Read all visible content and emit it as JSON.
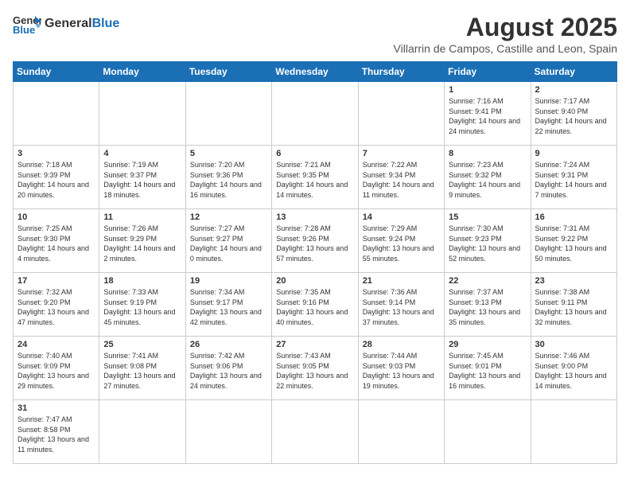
{
  "logo": {
    "text_general": "General",
    "text_blue": "Blue"
  },
  "calendar": {
    "title": "August 2025",
    "subtitle": "Villarrin de Campos, Castille and Leon, Spain",
    "headers": [
      "Sunday",
      "Monday",
      "Tuesday",
      "Wednesday",
      "Thursday",
      "Friday",
      "Saturday"
    ],
    "weeks": [
      [
        {
          "day": "",
          "info": ""
        },
        {
          "day": "",
          "info": ""
        },
        {
          "day": "",
          "info": ""
        },
        {
          "day": "",
          "info": ""
        },
        {
          "day": "",
          "info": ""
        },
        {
          "day": "1",
          "info": "Sunrise: 7:16 AM\nSunset: 9:41 PM\nDaylight: 14 hours and 24 minutes."
        },
        {
          "day": "2",
          "info": "Sunrise: 7:17 AM\nSunset: 9:40 PM\nDaylight: 14 hours and 22 minutes."
        }
      ],
      [
        {
          "day": "3",
          "info": "Sunrise: 7:18 AM\nSunset: 9:39 PM\nDaylight: 14 hours and 20 minutes."
        },
        {
          "day": "4",
          "info": "Sunrise: 7:19 AM\nSunset: 9:37 PM\nDaylight: 14 hours and 18 minutes."
        },
        {
          "day": "5",
          "info": "Sunrise: 7:20 AM\nSunset: 9:36 PM\nDaylight: 14 hours and 16 minutes."
        },
        {
          "day": "6",
          "info": "Sunrise: 7:21 AM\nSunset: 9:35 PM\nDaylight: 14 hours and 14 minutes."
        },
        {
          "day": "7",
          "info": "Sunrise: 7:22 AM\nSunset: 9:34 PM\nDaylight: 14 hours and 11 minutes."
        },
        {
          "day": "8",
          "info": "Sunrise: 7:23 AM\nSunset: 9:32 PM\nDaylight: 14 hours and 9 minutes."
        },
        {
          "day": "9",
          "info": "Sunrise: 7:24 AM\nSunset: 9:31 PM\nDaylight: 14 hours and 7 minutes."
        }
      ],
      [
        {
          "day": "10",
          "info": "Sunrise: 7:25 AM\nSunset: 9:30 PM\nDaylight: 14 hours and 4 minutes."
        },
        {
          "day": "11",
          "info": "Sunrise: 7:26 AM\nSunset: 9:29 PM\nDaylight: 14 hours and 2 minutes."
        },
        {
          "day": "12",
          "info": "Sunrise: 7:27 AM\nSunset: 9:27 PM\nDaylight: 14 hours and 0 minutes."
        },
        {
          "day": "13",
          "info": "Sunrise: 7:28 AM\nSunset: 9:26 PM\nDaylight: 13 hours and 57 minutes."
        },
        {
          "day": "14",
          "info": "Sunrise: 7:29 AM\nSunset: 9:24 PM\nDaylight: 13 hours and 55 minutes."
        },
        {
          "day": "15",
          "info": "Sunrise: 7:30 AM\nSunset: 9:23 PM\nDaylight: 13 hours and 52 minutes."
        },
        {
          "day": "16",
          "info": "Sunrise: 7:31 AM\nSunset: 9:22 PM\nDaylight: 13 hours and 50 minutes."
        }
      ],
      [
        {
          "day": "17",
          "info": "Sunrise: 7:32 AM\nSunset: 9:20 PM\nDaylight: 13 hours and 47 minutes."
        },
        {
          "day": "18",
          "info": "Sunrise: 7:33 AM\nSunset: 9:19 PM\nDaylight: 13 hours and 45 minutes."
        },
        {
          "day": "19",
          "info": "Sunrise: 7:34 AM\nSunset: 9:17 PM\nDaylight: 13 hours and 42 minutes."
        },
        {
          "day": "20",
          "info": "Sunrise: 7:35 AM\nSunset: 9:16 PM\nDaylight: 13 hours and 40 minutes."
        },
        {
          "day": "21",
          "info": "Sunrise: 7:36 AM\nSunset: 9:14 PM\nDaylight: 13 hours and 37 minutes."
        },
        {
          "day": "22",
          "info": "Sunrise: 7:37 AM\nSunset: 9:13 PM\nDaylight: 13 hours and 35 minutes."
        },
        {
          "day": "23",
          "info": "Sunrise: 7:38 AM\nSunset: 9:11 PM\nDaylight: 13 hours and 32 minutes."
        }
      ],
      [
        {
          "day": "24",
          "info": "Sunrise: 7:40 AM\nSunset: 9:09 PM\nDaylight: 13 hours and 29 minutes."
        },
        {
          "day": "25",
          "info": "Sunrise: 7:41 AM\nSunset: 9:08 PM\nDaylight: 13 hours and 27 minutes."
        },
        {
          "day": "26",
          "info": "Sunrise: 7:42 AM\nSunset: 9:06 PM\nDaylight: 13 hours and 24 minutes."
        },
        {
          "day": "27",
          "info": "Sunrise: 7:43 AM\nSunset: 9:05 PM\nDaylight: 13 hours and 22 minutes."
        },
        {
          "day": "28",
          "info": "Sunrise: 7:44 AM\nSunset: 9:03 PM\nDaylight: 13 hours and 19 minutes."
        },
        {
          "day": "29",
          "info": "Sunrise: 7:45 AM\nSunset: 9:01 PM\nDaylight: 13 hours and 16 minutes."
        },
        {
          "day": "30",
          "info": "Sunrise: 7:46 AM\nSunset: 9:00 PM\nDaylight: 13 hours and 14 minutes."
        }
      ],
      [
        {
          "day": "31",
          "info": "Sunrise: 7:47 AM\nSunset: 8:58 PM\nDaylight: 13 hours and 11 minutes."
        },
        {
          "day": "",
          "info": ""
        },
        {
          "day": "",
          "info": ""
        },
        {
          "day": "",
          "info": ""
        },
        {
          "day": "",
          "info": ""
        },
        {
          "day": "",
          "info": ""
        },
        {
          "day": "",
          "info": ""
        }
      ]
    ]
  }
}
